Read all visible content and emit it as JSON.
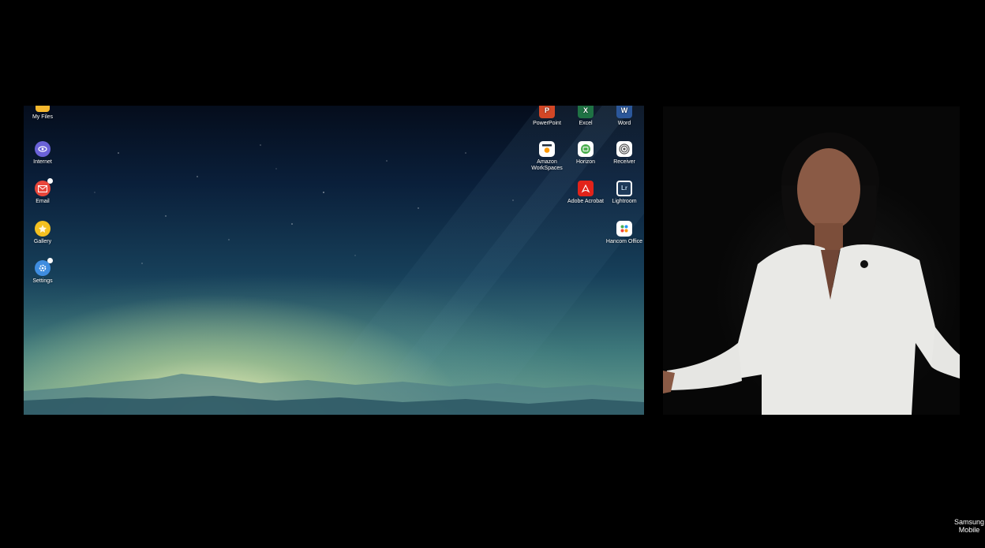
{
  "desktop": {
    "left_icons": [
      {
        "label": "My Files",
        "icon": "folder-icon",
        "color": "#f5b82e"
      },
      {
        "label": "Internet",
        "icon": "internet-icon",
        "color": "#6a62d8"
      },
      {
        "label": "Email",
        "icon": "email-icon",
        "color": "#e8463b"
      },
      {
        "label": "Gallery",
        "icon": "gallery-icon",
        "color": "#f3c020"
      },
      {
        "label": "Settings",
        "icon": "settings-icon",
        "color": "#3f8de0"
      }
    ],
    "right_icons": [
      {
        "label": "PowerPoint",
        "icon": "powerpoint-icon",
        "color": "#d24726",
        "glyph": "P"
      },
      {
        "label": "Excel",
        "icon": "excel-icon",
        "color": "#1f7244",
        "glyph": "X"
      },
      {
        "label": "Word",
        "icon": "word-icon",
        "color": "#2b579a",
        "glyph": "W"
      },
      {
        "label": "Amazon WorkSpaces",
        "icon": "amazon-workspaces-icon",
        "color": "#ff9900"
      },
      {
        "label": "Horizon",
        "icon": "horizon-icon",
        "color": "#4caf50"
      },
      {
        "label": "Receiver",
        "icon": "receiver-icon",
        "color": "#555555"
      },
      {
        "label": "Adobe Acrobat",
        "icon": "adobe-acrobat-icon",
        "color": "#e2231a"
      },
      {
        "label": "Lightroom",
        "icon": "lightroom-icon",
        "color": "#1e3a5a",
        "glyph": "Lr"
      },
      {
        "label": "Hancom Office",
        "icon": "hancom-office-icon",
        "color": "#ffffff"
      }
    ]
  },
  "watermark": {
    "line1": "Samsung",
    "line2": "Mobile"
  }
}
